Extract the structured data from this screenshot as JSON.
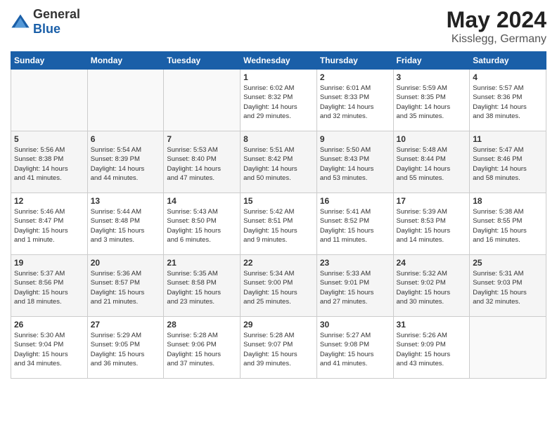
{
  "logo": {
    "general": "General",
    "blue": "Blue"
  },
  "header": {
    "month": "May 2024",
    "location": "Kisslegg, Germany"
  },
  "weekdays": [
    "Sunday",
    "Monday",
    "Tuesday",
    "Wednesday",
    "Thursday",
    "Friday",
    "Saturday"
  ],
  "weeks": [
    [
      {
        "day": "",
        "detail": ""
      },
      {
        "day": "",
        "detail": ""
      },
      {
        "day": "",
        "detail": ""
      },
      {
        "day": "1",
        "detail": "Sunrise: 6:02 AM\nSunset: 8:32 PM\nDaylight: 14 hours\nand 29 minutes."
      },
      {
        "day": "2",
        "detail": "Sunrise: 6:01 AM\nSunset: 8:33 PM\nDaylight: 14 hours\nand 32 minutes."
      },
      {
        "day": "3",
        "detail": "Sunrise: 5:59 AM\nSunset: 8:35 PM\nDaylight: 14 hours\nand 35 minutes."
      },
      {
        "day": "4",
        "detail": "Sunrise: 5:57 AM\nSunset: 8:36 PM\nDaylight: 14 hours\nand 38 minutes."
      }
    ],
    [
      {
        "day": "5",
        "detail": "Sunrise: 5:56 AM\nSunset: 8:38 PM\nDaylight: 14 hours\nand 41 minutes."
      },
      {
        "day": "6",
        "detail": "Sunrise: 5:54 AM\nSunset: 8:39 PM\nDaylight: 14 hours\nand 44 minutes."
      },
      {
        "day": "7",
        "detail": "Sunrise: 5:53 AM\nSunset: 8:40 PM\nDaylight: 14 hours\nand 47 minutes."
      },
      {
        "day": "8",
        "detail": "Sunrise: 5:51 AM\nSunset: 8:42 PM\nDaylight: 14 hours\nand 50 minutes."
      },
      {
        "day": "9",
        "detail": "Sunrise: 5:50 AM\nSunset: 8:43 PM\nDaylight: 14 hours\nand 53 minutes."
      },
      {
        "day": "10",
        "detail": "Sunrise: 5:48 AM\nSunset: 8:44 PM\nDaylight: 14 hours\nand 55 minutes."
      },
      {
        "day": "11",
        "detail": "Sunrise: 5:47 AM\nSunset: 8:46 PM\nDaylight: 14 hours\nand 58 minutes."
      }
    ],
    [
      {
        "day": "12",
        "detail": "Sunrise: 5:46 AM\nSunset: 8:47 PM\nDaylight: 15 hours\nand 1 minute."
      },
      {
        "day": "13",
        "detail": "Sunrise: 5:44 AM\nSunset: 8:48 PM\nDaylight: 15 hours\nand 3 minutes."
      },
      {
        "day": "14",
        "detail": "Sunrise: 5:43 AM\nSunset: 8:50 PM\nDaylight: 15 hours\nand 6 minutes."
      },
      {
        "day": "15",
        "detail": "Sunrise: 5:42 AM\nSunset: 8:51 PM\nDaylight: 15 hours\nand 9 minutes."
      },
      {
        "day": "16",
        "detail": "Sunrise: 5:41 AM\nSunset: 8:52 PM\nDaylight: 15 hours\nand 11 minutes."
      },
      {
        "day": "17",
        "detail": "Sunrise: 5:39 AM\nSunset: 8:53 PM\nDaylight: 15 hours\nand 14 minutes."
      },
      {
        "day": "18",
        "detail": "Sunrise: 5:38 AM\nSunset: 8:55 PM\nDaylight: 15 hours\nand 16 minutes."
      }
    ],
    [
      {
        "day": "19",
        "detail": "Sunrise: 5:37 AM\nSunset: 8:56 PM\nDaylight: 15 hours\nand 18 minutes."
      },
      {
        "day": "20",
        "detail": "Sunrise: 5:36 AM\nSunset: 8:57 PM\nDaylight: 15 hours\nand 21 minutes."
      },
      {
        "day": "21",
        "detail": "Sunrise: 5:35 AM\nSunset: 8:58 PM\nDaylight: 15 hours\nand 23 minutes."
      },
      {
        "day": "22",
        "detail": "Sunrise: 5:34 AM\nSunset: 9:00 PM\nDaylight: 15 hours\nand 25 minutes."
      },
      {
        "day": "23",
        "detail": "Sunrise: 5:33 AM\nSunset: 9:01 PM\nDaylight: 15 hours\nand 27 minutes."
      },
      {
        "day": "24",
        "detail": "Sunrise: 5:32 AM\nSunset: 9:02 PM\nDaylight: 15 hours\nand 30 minutes."
      },
      {
        "day": "25",
        "detail": "Sunrise: 5:31 AM\nSunset: 9:03 PM\nDaylight: 15 hours\nand 32 minutes."
      }
    ],
    [
      {
        "day": "26",
        "detail": "Sunrise: 5:30 AM\nSunset: 9:04 PM\nDaylight: 15 hours\nand 34 minutes."
      },
      {
        "day": "27",
        "detail": "Sunrise: 5:29 AM\nSunset: 9:05 PM\nDaylight: 15 hours\nand 36 minutes."
      },
      {
        "day": "28",
        "detail": "Sunrise: 5:28 AM\nSunset: 9:06 PM\nDaylight: 15 hours\nand 37 minutes."
      },
      {
        "day": "29",
        "detail": "Sunrise: 5:28 AM\nSunset: 9:07 PM\nDaylight: 15 hours\nand 39 minutes."
      },
      {
        "day": "30",
        "detail": "Sunrise: 5:27 AM\nSunset: 9:08 PM\nDaylight: 15 hours\nand 41 minutes."
      },
      {
        "day": "31",
        "detail": "Sunrise: 5:26 AM\nSunset: 9:09 PM\nDaylight: 15 hours\nand 43 minutes."
      },
      {
        "day": "",
        "detail": ""
      }
    ]
  ]
}
